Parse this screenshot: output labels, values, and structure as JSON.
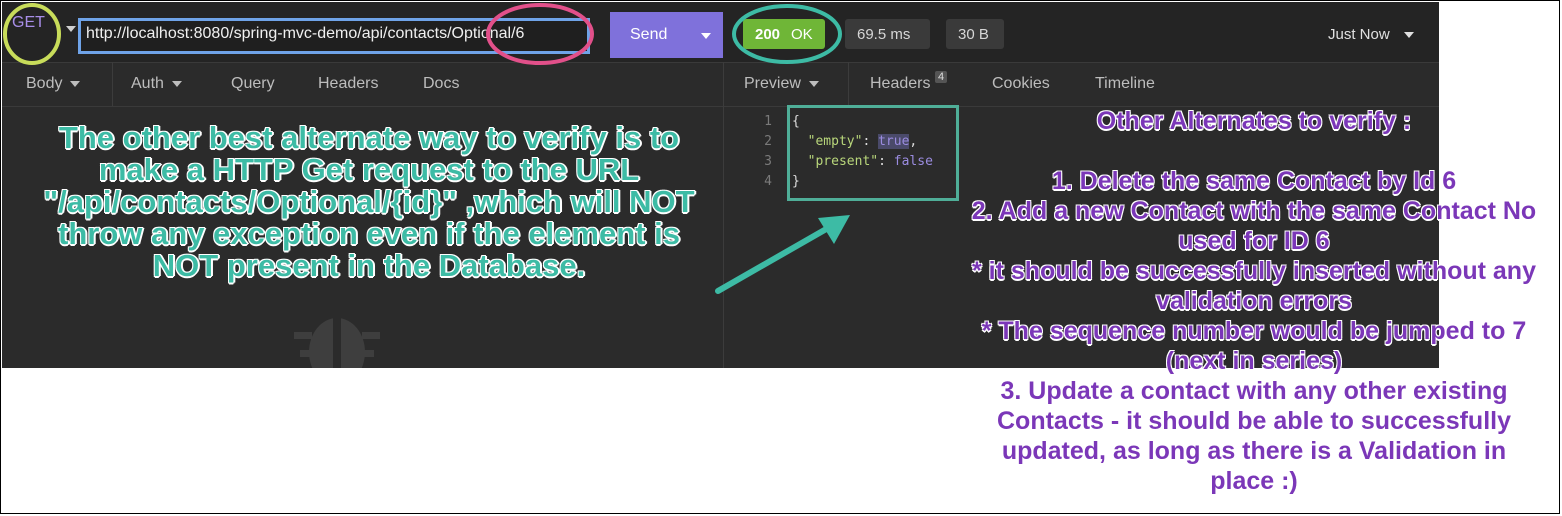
{
  "request": {
    "method": "GET",
    "url": "http://localhost:8080/spring-mvc-demo/api/contacts/Optional/6",
    "send_label": "Send"
  },
  "response": {
    "status_code": "200",
    "status_text": "OK",
    "time": "69.5 ms",
    "size": "30 B",
    "when": "Just Now",
    "status_color": "#6fb637"
  },
  "request_tabs": [
    {
      "label": "Body"
    },
    {
      "label": "Auth"
    },
    {
      "label": "Query"
    },
    {
      "label": "Headers"
    },
    {
      "label": "Docs"
    }
  ],
  "response_tabs": [
    {
      "label": "Preview"
    },
    {
      "label": "Headers",
      "badge": "4"
    },
    {
      "label": "Cookies"
    },
    {
      "label": "Timeline"
    }
  ],
  "json_lines": {
    "n1": "1",
    "n2": "2",
    "n3": "3",
    "n4": "4",
    "open": "{",
    "empty_key": "\"empty\"",
    "empty_val": "true",
    "present_key": "\"present\"",
    "present_val": "false",
    "close": "}"
  },
  "annotations": {
    "left": "The other best alternate way to verify is to make a HTTP Get request to the URL \"/api/contacts/Optional/{id}\" ,which will NOT throw any exception even if the element is NOT present in the Database.",
    "right_lines": [
      "Other Alternates to verify :",
      "",
      "1. Delete the same Contact by Id 6",
      "2. Add a new Contact with the same Contact No",
      "used for ID 6",
      "* it should be successfully inserted without any",
      "validation errors",
      "* The sequence number would be jumped to 7",
      "(next in series)",
      "3. Update a contact with any other existing",
      "Contacts - it should be able to successfully",
      "updated, as long as there is a Validation in",
      "place :)"
    ],
    "colors": {
      "teal": "#3dbba5",
      "purple": "#7b37b8",
      "green_circle": "#c8dc5a",
      "pink_circle": "#e2508a",
      "blue_box": "#6fa3e8"
    }
  },
  "icons": {
    "method_caret": "chevron-down-icon",
    "bug": "bug-icon",
    "arrow": "arrow-icon"
  }
}
